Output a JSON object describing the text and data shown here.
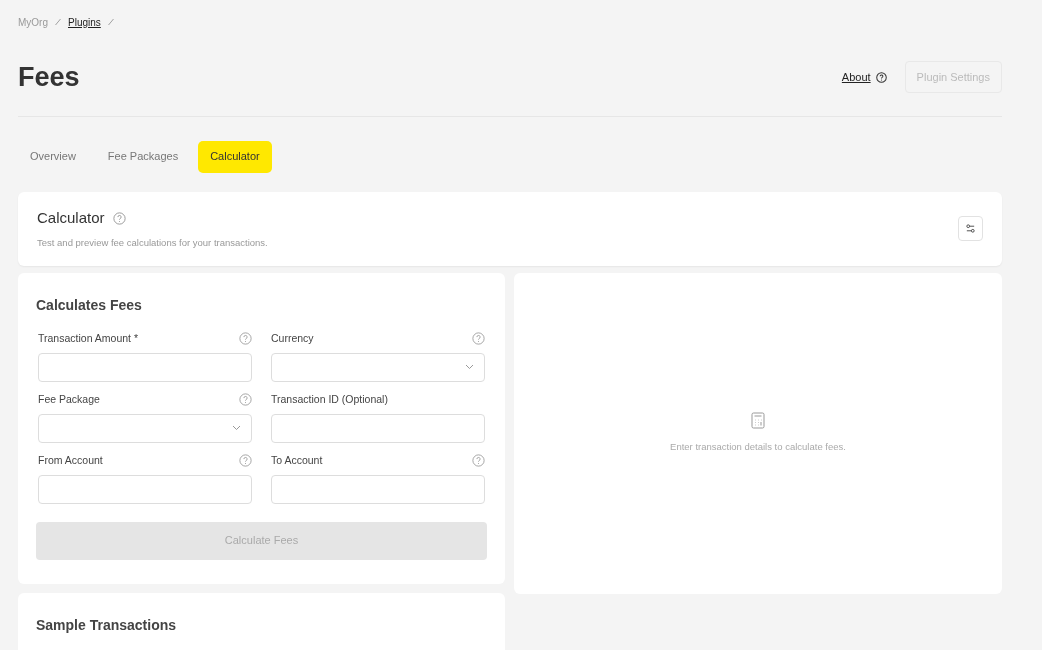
{
  "breadcrumb": [
    {
      "label": "MyOrg",
      "link": false
    },
    {
      "label": "Plugins",
      "link": true
    }
  ],
  "page": {
    "title": "Fees",
    "about_link": "About",
    "settings_button": {
      "label": "Plugin Settings",
      "disabled": true
    }
  },
  "tabs": [
    {
      "label": "Overview",
      "selected": false
    },
    {
      "label": "Fee Packages",
      "selected": false
    },
    {
      "label": "Calculator",
      "selected": true
    }
  ],
  "calculator_header": {
    "title": "Calculator",
    "subtitle": "Test and preview fee calculations for your transactions."
  },
  "form": {
    "title": "Calculates Fees",
    "fields": [
      {
        "label": "Transaction Amount *",
        "kind": "text",
        "help": true
      },
      {
        "label": "Currency",
        "kind": "select",
        "help": true
      },
      {
        "label": "Fee Package",
        "kind": "select",
        "help": true
      },
      {
        "label": "Transaction ID (Optional)",
        "kind": "text",
        "help": false
      },
      {
        "label": "From Account",
        "kind": "text",
        "help": true
      },
      {
        "label": "To Account",
        "kind": "text",
        "help": true
      }
    ],
    "submit": {
      "label": "Calculate Fees",
      "disabled": true
    }
  },
  "result": {
    "empty_message": "Enter transaction details to calculate fees."
  },
  "samples": {
    "title": "Sample Transactions"
  }
}
